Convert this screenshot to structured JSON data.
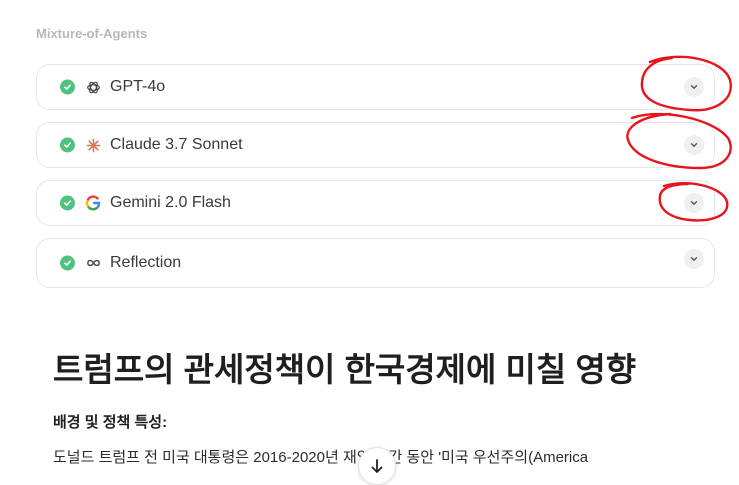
{
  "section": {
    "label": "Mixture-of-Agents"
  },
  "agents": [
    {
      "name": "GPT-4o",
      "status": "complete",
      "icon": "openai-icon"
    },
    {
      "name": "Claude 3.7 Sonnet",
      "status": "complete",
      "icon": "claude-icon"
    },
    {
      "name": "Gemini 2.0 Flash",
      "status": "complete",
      "icon": "google-icon"
    },
    {
      "name": "Reflection",
      "status": "complete",
      "icon": "infinity-icon"
    }
  ],
  "article": {
    "title": "트럼프의 관세정책이 한국경제에 미칠 영향",
    "subheading": "배경 및 정책 특성:",
    "paragraph": "도널드 트럼프 전 미국 대통령은 2016-2020년 재임 기간 동안 '미국 우선주의(America"
  },
  "colors": {
    "check": "#4fc27d",
    "annotation": "#e8141c",
    "label": "#b8b8b8"
  }
}
